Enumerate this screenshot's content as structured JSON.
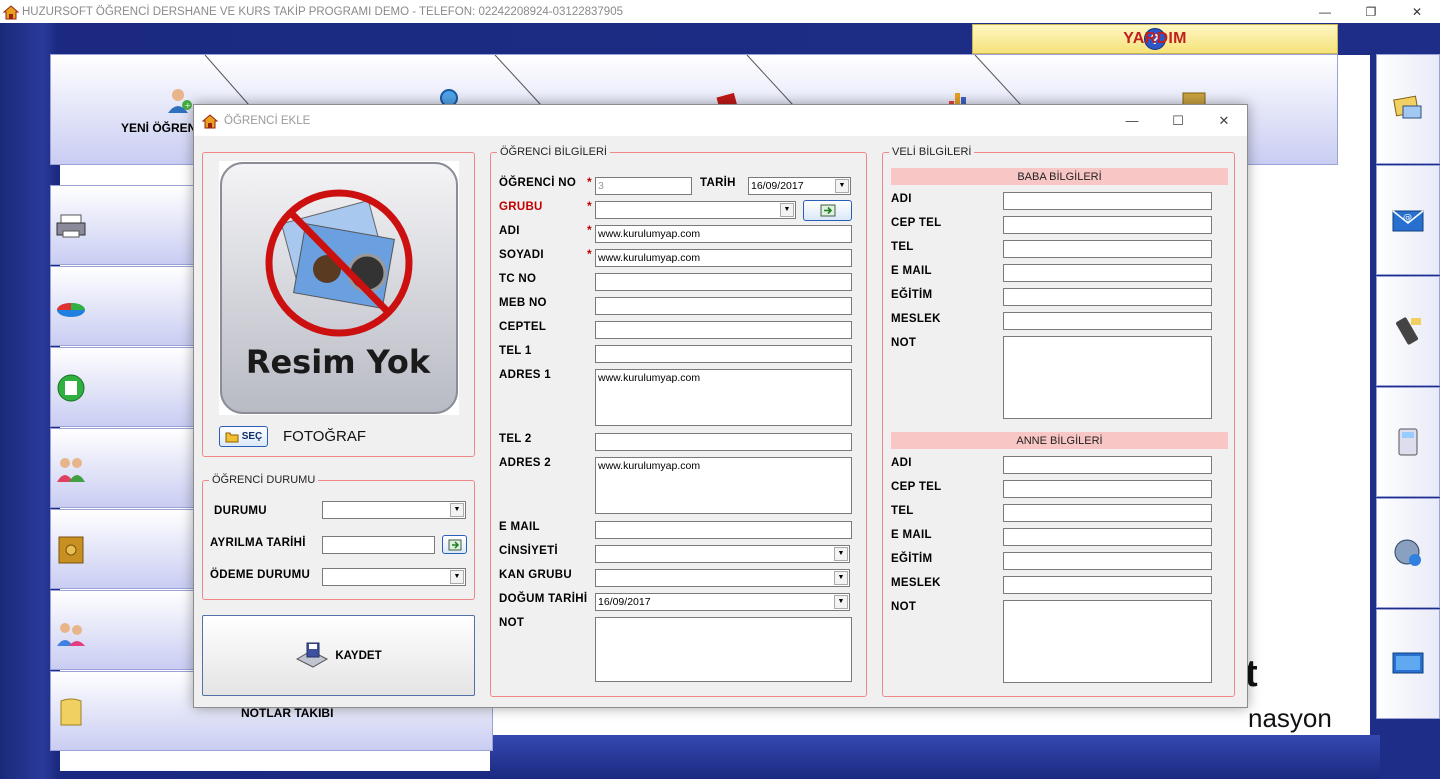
{
  "window": {
    "title": "HUZURSOFT ÖĞRENCİ DERSHANE VE KURS TAKİP PROGRAMI DEMO - TELEFON: 02242208924-03122837905",
    "minimize": "—",
    "maximize": "❐",
    "close": "✕"
  },
  "help": {
    "label": "YARDIM",
    "icon_glyph": "?"
  },
  "top_menu": {
    "first_label": "YENİ ÖĞREN"
  },
  "left_menu": {
    "bottom_label": "NOTLAR TAKIBI"
  },
  "background": {
    "brand_fragment": "t",
    "brand_tagline_fragment": "nasyon"
  },
  "dialog": {
    "title": "ÖĞRENCİ EKLE",
    "minimize": "—",
    "maximize": "☐",
    "close": "✕",
    "photo": {
      "placeholder_text": "Resim Yok",
      "select_button": "SEÇ",
      "caption": "FOTOĞRAF"
    },
    "status_group": {
      "title": "ÖĞRENCİ DURUMU",
      "status_label": "DURUMU",
      "leave_date_label": "AYRILMA TARİHİ",
      "payment_label": "ÖDEME DURUMU"
    },
    "save_button": "KAYDET",
    "student_group": {
      "title": "ÖĞRENCİ BİLGİLERİ",
      "no_label": "ÖĞRENCİ NO",
      "no_value": "3",
      "date_label": "TARİH",
      "date_value": "16/09/2017",
      "group_label": "GRUBU",
      "name_label": "ADI",
      "name_value": "www.kurulumyap.com",
      "surname_label": "SOYADI",
      "surname_value": "www.kurulumyap.com",
      "tc_label": "TC NO",
      "meb_label": "MEB NO",
      "mobile_label": "CEPTEL",
      "tel1_label": "TEL 1",
      "address1_label": "ADRES 1",
      "address1_value": "www.kurulumyap.com",
      "tel2_label": "TEL 2",
      "address2_label": "ADRES 2",
      "address2_value": "www.kurulumyap.com",
      "email_label": "E MAIL",
      "gender_label": "CİNSİYETİ",
      "blood_label": "KAN GRUBU",
      "birth_label": "DOĞUM TARİHİ",
      "birth_value": "16/09/2017",
      "note_label": "NOT",
      "required_mark": "*"
    },
    "parent_group": {
      "title": "VELİ BİLGİLERİ",
      "father_header": "BABA BİLGİLERİ",
      "mother_header": "ANNE BİLGİLERİ",
      "labels": [
        "ADI",
        "CEP TEL",
        "TEL",
        "E MAIL",
        "EĞİTİM",
        "MESLEK",
        "NOT"
      ]
    }
  }
}
